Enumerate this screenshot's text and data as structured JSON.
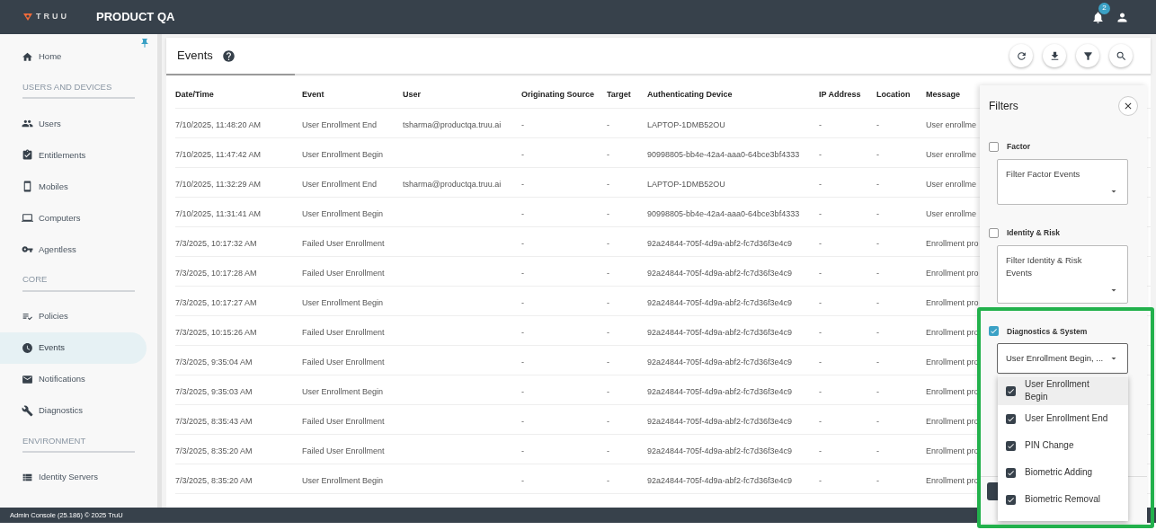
{
  "header": {
    "logo": "TRUU",
    "title": "PRODUCT QA",
    "notification_count": "2"
  },
  "sidebar": {
    "sections": [
      {
        "items": [
          {
            "label": "Home",
            "selected": false
          }
        ]
      },
      {
        "heading": "USERS AND DEVICES",
        "items": [
          {
            "label": "Users",
            "selected": false
          },
          {
            "label": "Entitlements",
            "selected": false
          },
          {
            "label": "Mobiles",
            "selected": false
          },
          {
            "label": "Computers",
            "selected": false
          },
          {
            "label": "Agentless",
            "selected": false
          }
        ]
      },
      {
        "heading": "CORE",
        "items": [
          {
            "label": "Policies",
            "selected": false
          },
          {
            "label": "Events",
            "selected": true
          },
          {
            "label": "Notifications",
            "selected": false
          },
          {
            "label": "Diagnostics",
            "selected": false
          }
        ]
      },
      {
        "heading": "ENVIRONMENT",
        "items": [
          {
            "label": "Identity Servers",
            "selected": false
          }
        ]
      }
    ]
  },
  "page": {
    "title": "Events"
  },
  "table": {
    "columns": [
      "Date/Time",
      "Event",
      "User",
      "Originating Source",
      "Target",
      "Authenticating Device",
      "IP Address",
      "Location",
      "Message"
    ],
    "rows": [
      [
        "7/10/2025, 11:48:20 AM",
        "User Enrollment End",
        "tsharma@productqa.truu.ai",
        "-",
        "-",
        "LAPTOP-1DMB52OU",
        "-",
        "-",
        "User enrollme"
      ],
      [
        "7/10/2025, 11:47:42 AM",
        "User Enrollment Begin",
        "",
        "-",
        "-",
        "90998805-bb4e-42a4-aaa0-64bce3bf4333",
        "-",
        "-",
        "User enrollme"
      ],
      [
        "7/10/2025, 11:32:29 AM",
        "User Enrollment End",
        "tsharma@productqa.truu.ai",
        "-",
        "-",
        "LAPTOP-1DMB52OU",
        "-",
        "-",
        "User enrollme"
      ],
      [
        "7/10/2025, 11:31:41 AM",
        "User Enrollment Begin",
        "",
        "-",
        "-",
        "90998805-bb4e-42a4-aaa0-64bce3bf4333",
        "-",
        "-",
        "User enrollme"
      ],
      [
        "7/3/2025, 10:17:32 AM",
        "Failed User Enrollment",
        "",
        "-",
        "-",
        "92a24844-705f-4d9a-abf2-fc7d36f3e4c9",
        "-",
        "-",
        "Enrollment pro"
      ],
      [
        "7/3/2025, 10:17:28 AM",
        "Failed User Enrollment",
        "",
        "-",
        "-",
        "92a24844-705f-4d9a-abf2-fc7d36f3e4c9",
        "-",
        "-",
        "Enrollment pro"
      ],
      [
        "7/3/2025, 10:17:27 AM",
        "User Enrollment Begin",
        "",
        "-",
        "-",
        "92a24844-705f-4d9a-abf2-fc7d36f3e4c9",
        "-",
        "-",
        "Enrollment pro"
      ],
      [
        "7/3/2025, 10:15:26 AM",
        "Failed User Enrollment",
        "",
        "-",
        "-",
        "92a24844-705f-4d9a-abf2-fc7d36f3e4c9",
        "-",
        "-",
        "Enrollment pro"
      ],
      [
        "7/3/2025, 9:35:04 AM",
        "Failed User Enrollment",
        "",
        "-",
        "-",
        "92a24844-705f-4d9a-abf2-fc7d36f3e4c9",
        "-",
        "-",
        "Enrollment pro"
      ],
      [
        "7/3/2025, 9:35:03 AM",
        "User Enrollment Begin",
        "",
        "-",
        "-",
        "92a24844-705f-4d9a-abf2-fc7d36f3e4c9",
        "-",
        "-",
        "Enrollment pro"
      ],
      [
        "7/3/2025, 8:35:43 AM",
        "Failed User Enrollment",
        "",
        "-",
        "-",
        "92a24844-705f-4d9a-abf2-fc7d36f3e4c9",
        "-",
        "-",
        "Enrollment pro"
      ],
      [
        "7/3/2025, 8:35:20 AM",
        "Failed User Enrollment",
        "",
        "-",
        "-",
        "92a24844-705f-4d9a-abf2-fc7d36f3e4c9",
        "-",
        "-",
        "Enrollment pro"
      ],
      [
        "7/3/2025, 8:35:20 AM",
        "User Enrollment Begin",
        "",
        "-",
        "-",
        "92a24844-705f-4d9a-abf2-fc7d36f3e4c9",
        "-",
        "-",
        "Enrollment pro"
      ]
    ]
  },
  "filters": {
    "title": "Filters",
    "categories": [
      {
        "label": "Factor",
        "checked": false,
        "placeholder": "Filter Factor Events"
      },
      {
        "label": "Identity & Risk",
        "checked": false,
        "placeholder": "Filter Identity & Risk Events"
      },
      {
        "label": "Diagnostics & System",
        "checked": true,
        "value": "User Enrollment Begin, ..."
      }
    ],
    "dropdown": [
      {
        "label": "User Enrollment Begin",
        "checked": true,
        "highlighted": true
      },
      {
        "label": "User Enrollment End",
        "checked": true,
        "highlighted": false
      },
      {
        "label": "PIN Change",
        "checked": true,
        "highlighted": false
      },
      {
        "label": "Biometric Adding",
        "checked": true,
        "highlighted": false
      },
      {
        "label": "Biometric Removal",
        "checked": true,
        "highlighted": false
      }
    ]
  },
  "footer": {
    "text": "Admin Console (25.186) © 2025 TruU"
  }
}
